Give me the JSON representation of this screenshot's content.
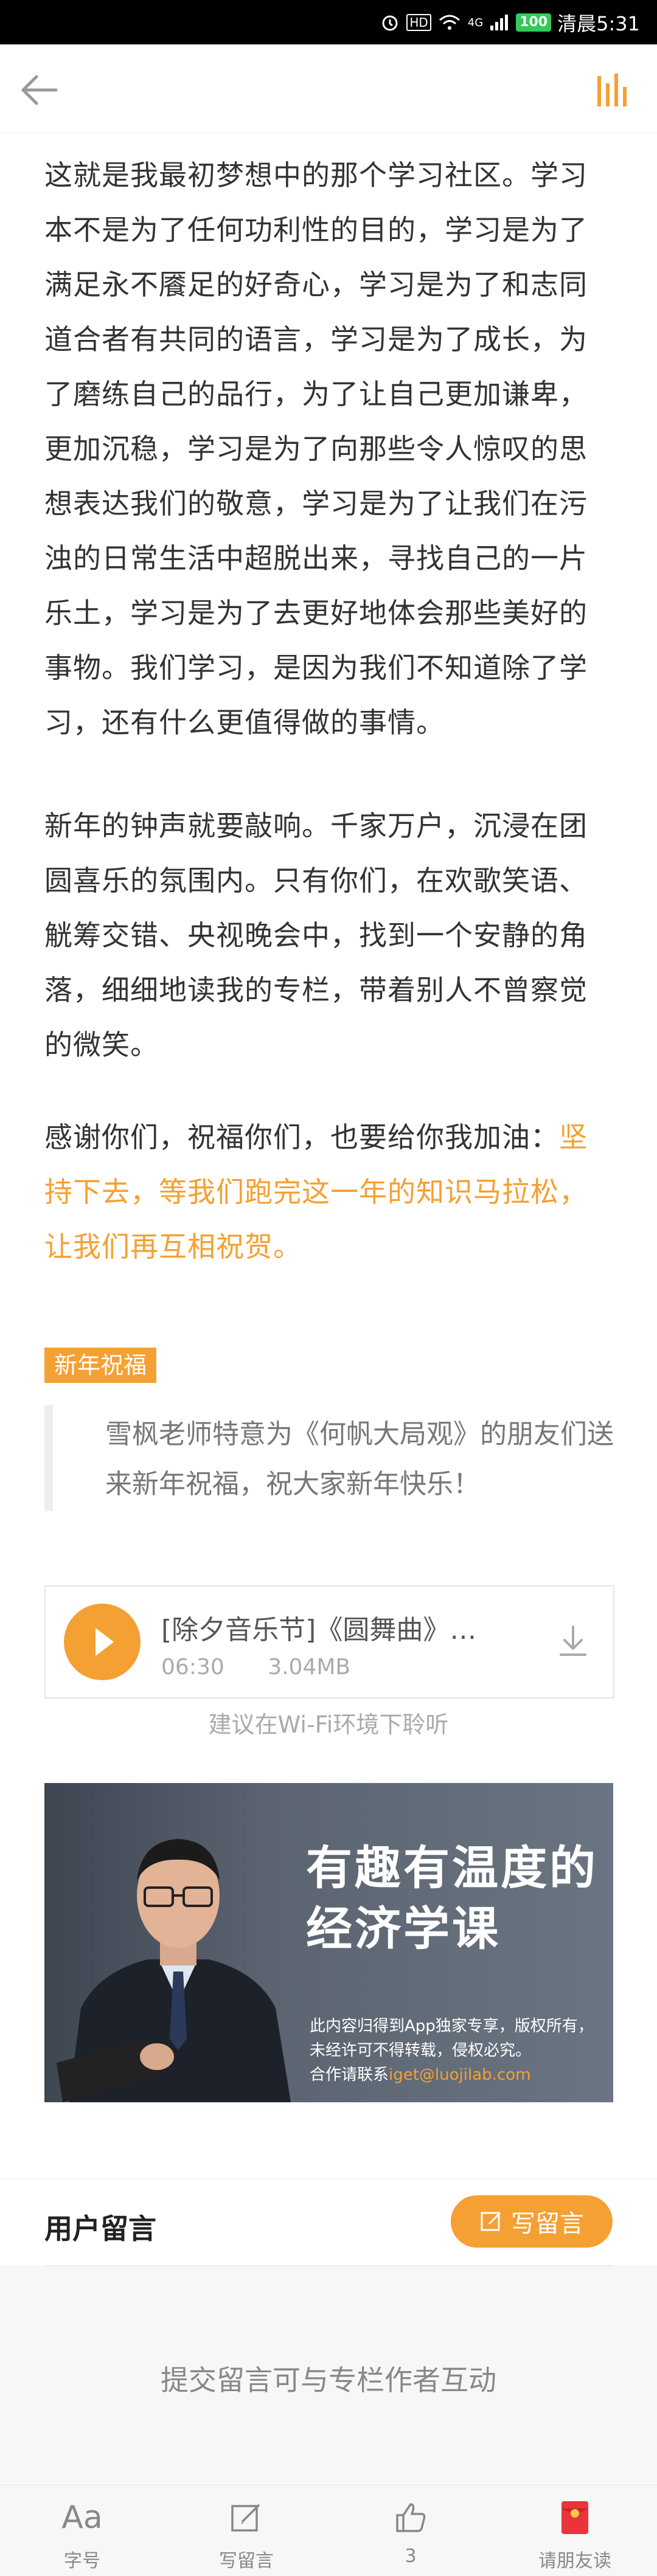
{
  "status_bar": {
    "time_label": "清晨5:31",
    "battery": "100",
    "network": "4G"
  },
  "article": {
    "p1": "这就是我最初梦想中的那个学习社区。学习本不是为了任何功利性的目的，学习是为了满足永不餍足的好奇心，学习是为了和志同道合者有共同的语言，学习是为了成长，为了磨练自己的品行，为了让自己更加谦卑，更加沉稳，学习是为了向那些令人惊叹的思想表达我们的敬意，学习是为了让我们在污浊的日常生活中超脱出来，寻找自己的一片乐土，学习是为了去更好地体会那些美好的事物。我们学习，是因为我们不知道除了学习，还有什么更值得做的事情。",
    "p2": "新年的钟声就要敲响。千家万户，沉浸在团圆喜乐的氛围内。只有你们，在欢歌笑语、觥筹交错、央视晚会中，找到一个安静的角落，细细地读我的专栏，带着别人不曾察觉的微笑。",
    "p3_plain": "感谢你们，祝福你们，也要给你我加油：",
    "p3_highlight": "坚持下去，等我们跑完这一年的知识马拉松，让我们再互相祝贺。"
  },
  "section_tag": "新年祝福",
  "quote": "雪枫老师特意为《何帆大局观》的朋友们送来新年祝福，祝大家新年快乐！",
  "audio": {
    "title": "[除夕音乐节]《圆舞曲》…",
    "duration": "06:30",
    "size": "3.04MB",
    "tip": "建议在Wi-Fi环境下聆听"
  },
  "banner": {
    "headline_1": "有趣有温度的",
    "headline_2": "经济学课",
    "copyright": "此内容归得到App独家专享，版权所有，未经许可不得转载，侵权必究。",
    "contact_prefix": "合作请联系",
    "contact_email": "iget@luojilab.com"
  },
  "comments": {
    "title": "用户留言",
    "write_button": "写留言",
    "empty_hint": "提交留言可与专栏作者互动"
  },
  "tabbar": {
    "items": [
      {
        "label": "字号",
        "icon": "font-size-icon"
      },
      {
        "label": "写留言",
        "icon": "edit-icon"
      },
      {
        "label": "3",
        "icon": "thumbs-up-icon"
      },
      {
        "label": "请朋友读",
        "icon": "red-envelope-icon"
      }
    ]
  },
  "colors": {
    "accent": "#f5a032",
    "text": "#333333",
    "muted": "#888888"
  }
}
